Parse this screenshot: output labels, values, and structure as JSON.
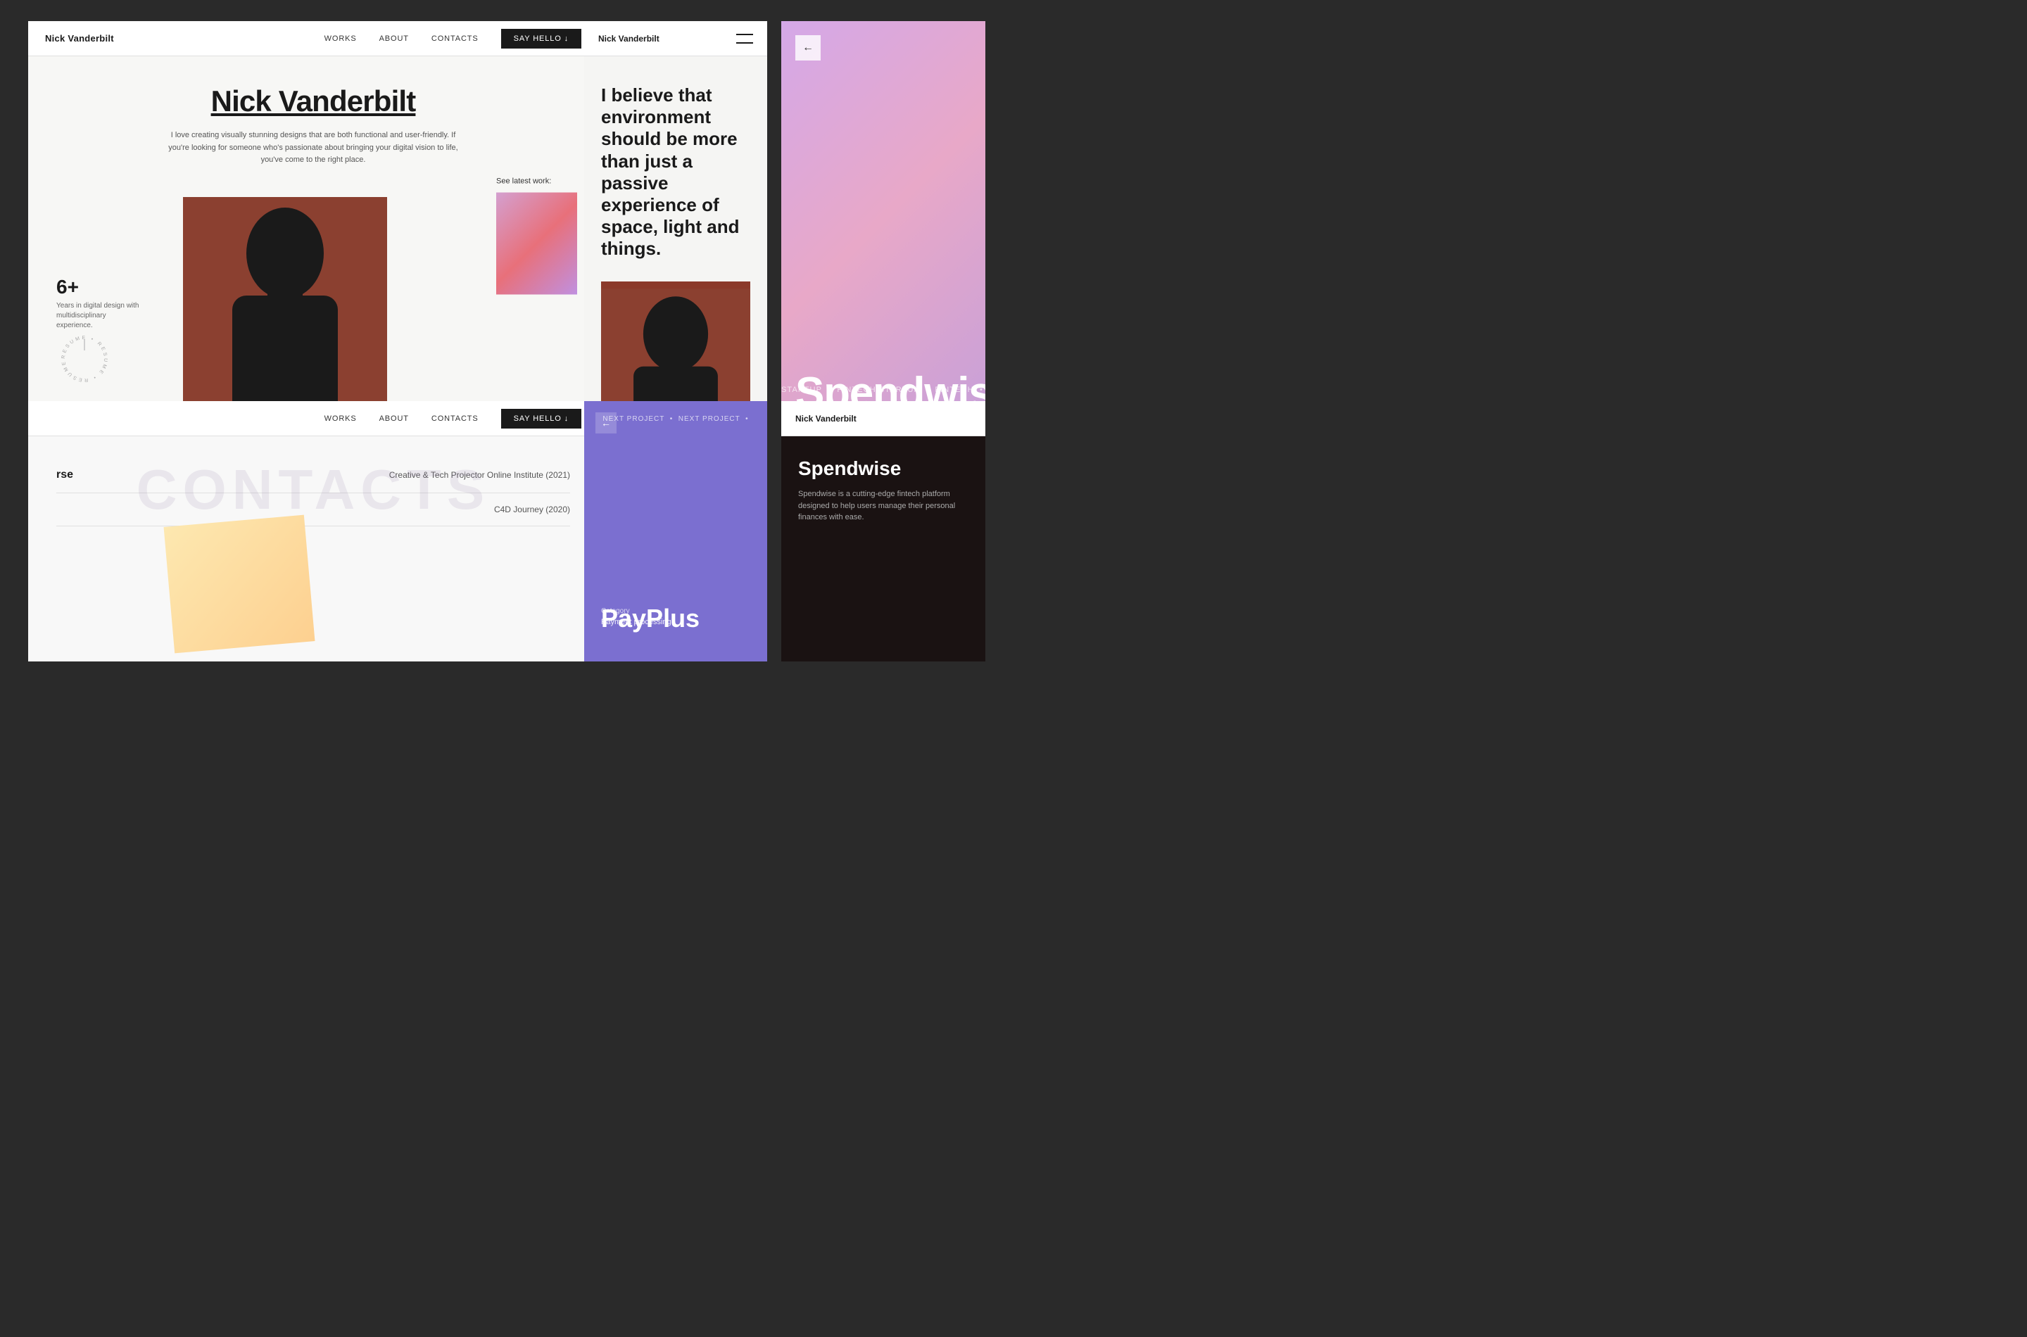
{
  "panels": {
    "panel1": {
      "navbar": {
        "brand": "Nick Vanderbilt",
        "links": [
          "WORKS",
          "ABOUT",
          "CONTACTS"
        ],
        "cta": "SAY HELLO ↓"
      },
      "hero": {
        "title": "Nick Vanderbilt",
        "subtitle": "I love creating visually stunning designs that are both functional and user-friendly. If you're looking for someone who's passionate about bringing your digital vision to life, you've come to the right place.",
        "stat_number": "6+",
        "stat_text": "Years in digital design with multidisciplinary experience.",
        "resume_circle": "RESUME",
        "latest_work_label": "See latest work:"
      }
    },
    "panel2": {
      "navbar": {
        "brand": "Nick Vanderbilt",
        "menu_icon": "☰"
      },
      "quote": "I believe that environment should be more than just a passive experience of space, light and things."
    },
    "panel3": {
      "back_icon": "←",
      "ticker": "STARTUP • FINTECH STARTUP • FINTECH",
      "big_text": "Spendwis"
    },
    "panel4": {
      "navbar": {
        "links": [
          "WORKS",
          "ABOUT",
          "CONTACTS"
        ],
        "cta": "SAY HELLO ↓"
      },
      "edu_items": [
        {
          "left": "rse",
          "right": "Creative & Tech Projector Online Institute (2021)"
        },
        {
          "left": "",
          "right": "C4D Journey (2020)"
        }
      ]
    },
    "panel5": {
      "back_icon": "←",
      "ticker": "NEXT PROJECT • NEXT PROJECT •",
      "project_name": "PayPlus",
      "category_label": "Category",
      "category_value": "Payment processing"
    },
    "panel6": {
      "navbar": {
        "brand": "Nick Vanderbilt"
      },
      "project": {
        "title": "Spendwise",
        "description": "Spendwise is a cutting-edge fintech platform designed to help users manage their personal finances with ease."
      }
    }
  },
  "contacts_watermark": "CONTACTS",
  "contacts_nav_label": "CONTACTS"
}
